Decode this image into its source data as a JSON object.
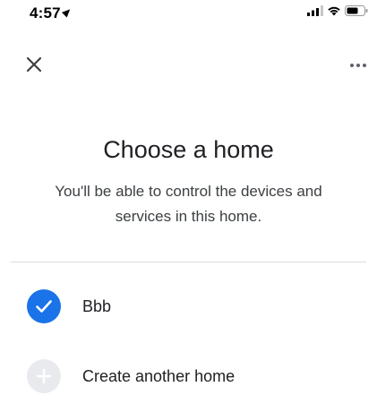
{
  "status_bar": {
    "time": "4:57",
    "icons": [
      "location-arrow-icon",
      "signal-icon",
      "wifi-icon",
      "battery-icon"
    ]
  },
  "top_bar": {
    "close_icon": "close-icon",
    "more_icon": "more-options-icon"
  },
  "main": {
    "title": "Choose a home",
    "subtitle": "You'll be able to control the devices and services in this home."
  },
  "homes": [
    {
      "label": "Bbb",
      "selected": true,
      "icon": "checkmark-icon"
    }
  ],
  "create_home": {
    "label": "Create another home",
    "icon": "plus-icon"
  },
  "colors": {
    "accent": "#1a73e8",
    "text_primary": "#202124",
    "text_secondary": "#3c4043",
    "divider": "#dadce0",
    "plus_circle": "#e8eaed"
  }
}
